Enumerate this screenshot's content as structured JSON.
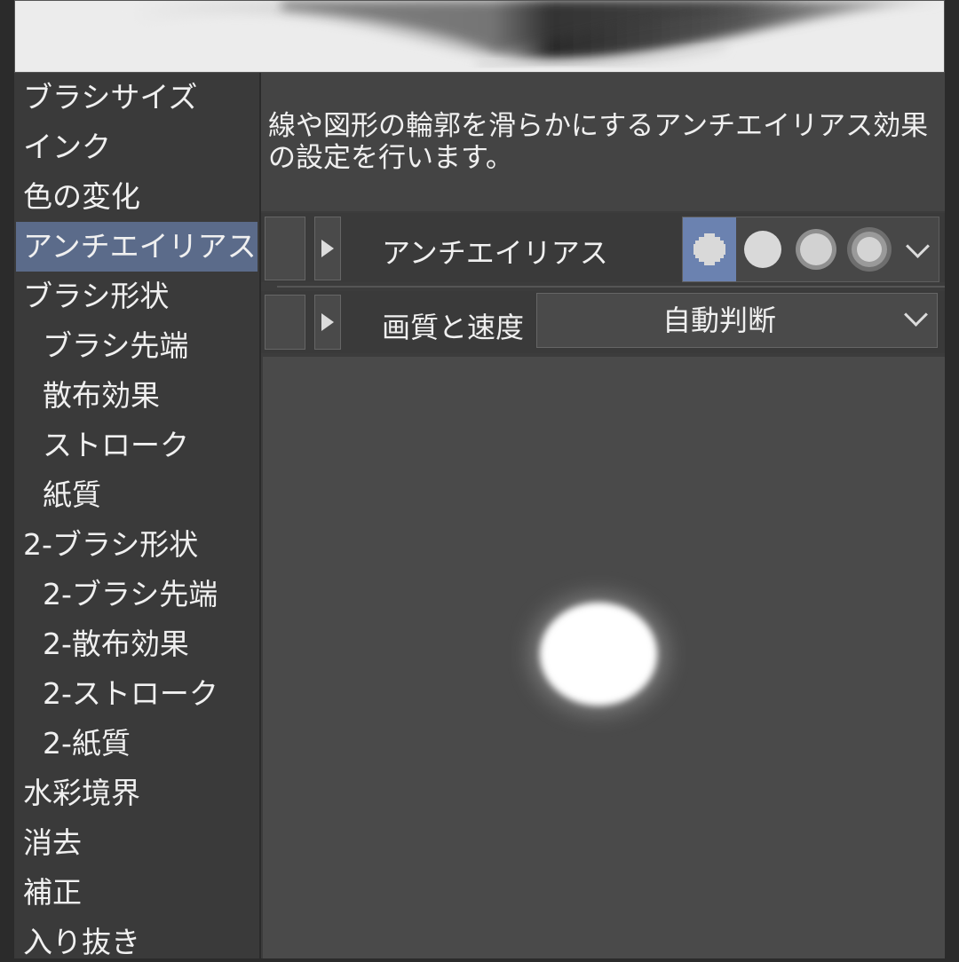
{
  "sidebar": {
    "items": [
      {
        "label": "ブラシサイズ",
        "indent": false,
        "selected": false
      },
      {
        "label": "インク",
        "indent": false,
        "selected": false
      },
      {
        "label": "色の変化",
        "indent": false,
        "selected": false
      },
      {
        "label": "アンチエイリアス",
        "indent": false,
        "selected": true
      },
      {
        "label": "ブラシ形状",
        "indent": false,
        "selected": false
      },
      {
        "label": "ブラシ先端",
        "indent": true,
        "selected": false
      },
      {
        "label": "散布効果",
        "indent": true,
        "selected": false
      },
      {
        "label": "ストローク",
        "indent": true,
        "selected": false
      },
      {
        "label": "紙質",
        "indent": true,
        "selected": false
      },
      {
        "label": "2-ブラシ形状",
        "indent": false,
        "selected": false
      },
      {
        "label": "2-ブラシ先端",
        "indent": true,
        "selected": false
      },
      {
        "label": "2-散布効果",
        "indent": true,
        "selected": false
      },
      {
        "label": "2-ストローク",
        "indent": true,
        "selected": false
      },
      {
        "label": "2-紙質",
        "indent": true,
        "selected": false
      },
      {
        "label": "水彩境界",
        "indent": false,
        "selected": false
      },
      {
        "label": "消去",
        "indent": false,
        "selected": false
      },
      {
        "label": "補正",
        "indent": false,
        "selected": false
      },
      {
        "label": "入り抜き",
        "indent": false,
        "selected": false
      }
    ]
  },
  "description": "線や図形の輪郭を滑らかにするアンチエイリアス効果の設定を行います。",
  "antialias_row": {
    "label": "アンチエイリアス",
    "options": [
      "none-icon",
      "weak-icon",
      "medium-icon",
      "strong-icon"
    ],
    "selected_index": 0
  },
  "quality_row": {
    "label": "画質と速度",
    "value": "自動判断"
  },
  "colors": {
    "selected_bg": "#5b6b8a",
    "active_option": "#6b82b0"
  }
}
